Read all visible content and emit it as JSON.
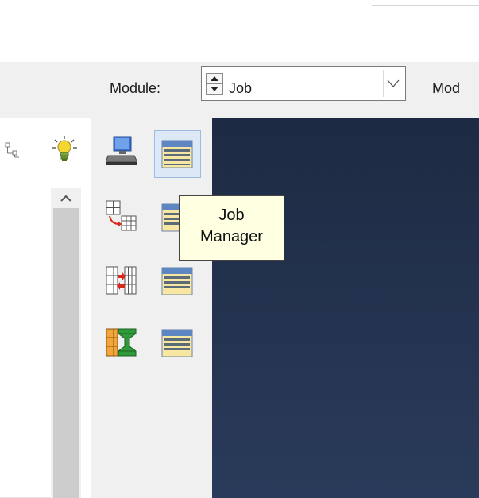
{
  "module_toolbar": {
    "module_label": "Module:",
    "module_value": "Job",
    "model_label_partial": "Mod"
  },
  "icons": {
    "tree_toolbar": [
      "tree-expand-icon",
      "lightbulb-icon"
    ],
    "toolbox": [
      "job-create-icon",
      "job-manager-icon",
      "adaptivity-create-icon",
      "adaptivity-manager-icon",
      "coexecution-create-icon",
      "coexecution-manager-icon",
      "optimization-create-icon",
      "optimization-manager-icon"
    ]
  },
  "tooltip": {
    "text": "Job\nManager",
    "line1": "Job",
    "line2": "Manager"
  },
  "colors": {
    "viewport_top": "#1d2a43",
    "viewport_bottom": "#2a3b5a",
    "hover_highlight": "#dce8f6",
    "tooltip_bg": "#ffffe1"
  }
}
